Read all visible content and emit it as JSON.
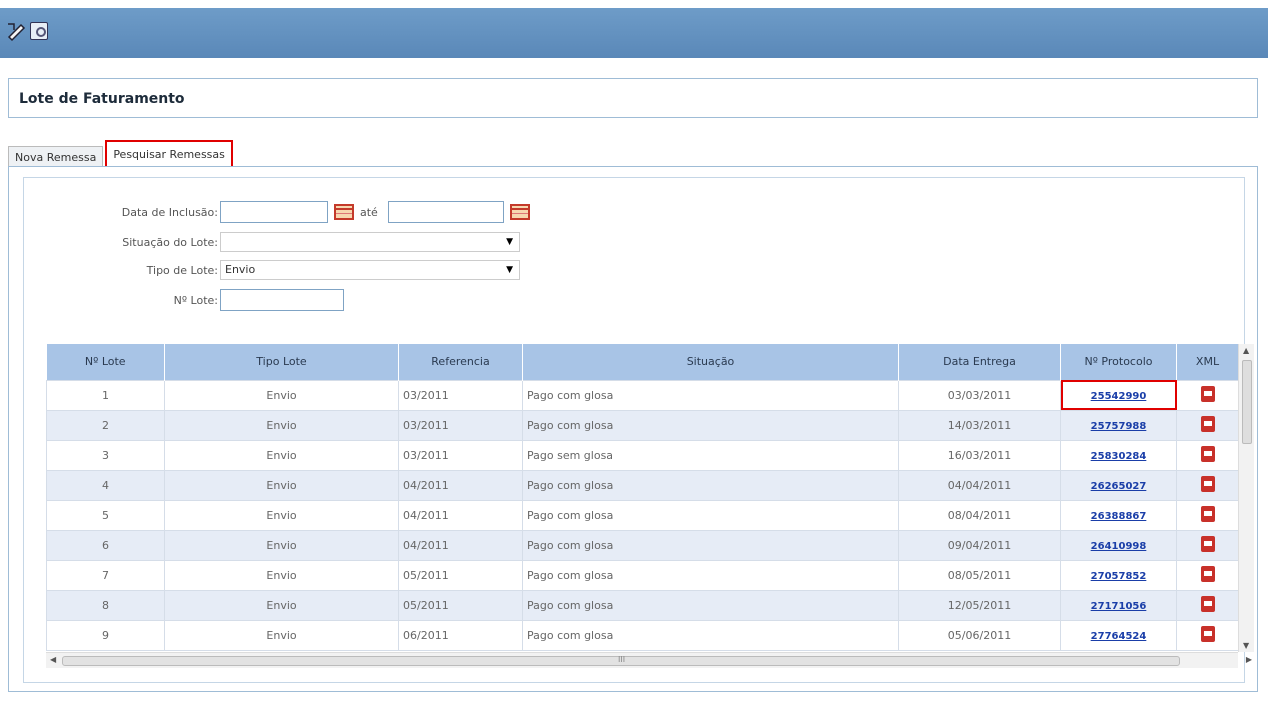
{
  "toolbar": {
    "icons": [
      "edit-pencil-icon",
      "download-icon"
    ]
  },
  "page_title": "Lote de Faturamento",
  "tabs": [
    {
      "label": "Nova Remessa",
      "active": false
    },
    {
      "label": "Pesquisar Remessas",
      "active": true
    }
  ],
  "form": {
    "data_inclusao_label": "Data de Inclusão:",
    "ate_label": "até",
    "data_inicio_value": "",
    "data_fim_value": "",
    "situacao_label": "Situação do Lote:",
    "situacao_value": "",
    "tipo_label": "Tipo de Lote:",
    "tipo_value": "Envio",
    "numero_label": "Nº Lote:",
    "numero_value": ""
  },
  "grid": {
    "headers": [
      "Nº Lote",
      "Tipo Lote",
      "Referencia",
      "Situação",
      "Data Entrega",
      "Nº Protocolo",
      "XML"
    ],
    "rows": [
      {
        "lote": "1",
        "tipo": "Envio",
        "ref": "03/2011",
        "situacao": "Pago com glosa",
        "data": "03/03/2011",
        "protocolo": "25542990"
      },
      {
        "lote": "2",
        "tipo": "Envio",
        "ref": "03/2011",
        "situacao": "Pago com glosa",
        "data": "14/03/2011",
        "protocolo": "25757988"
      },
      {
        "lote": "3",
        "tipo": "Envio",
        "ref": "03/2011",
        "situacao": "Pago sem glosa",
        "data": "16/03/2011",
        "protocolo": "25830284"
      },
      {
        "lote": "4",
        "tipo": "Envio",
        "ref": "04/2011",
        "situacao": "Pago com glosa",
        "data": "04/04/2011",
        "protocolo": "26265027"
      },
      {
        "lote": "5",
        "tipo": "Envio",
        "ref": "04/2011",
        "situacao": "Pago com glosa",
        "data": "08/04/2011",
        "protocolo": "26388867"
      },
      {
        "lote": "6",
        "tipo": "Envio",
        "ref": "04/2011",
        "situacao": "Pago com glosa",
        "data": "09/04/2011",
        "protocolo": "26410998"
      },
      {
        "lote": "7",
        "tipo": "Envio",
        "ref": "05/2011",
        "situacao": "Pago com glosa",
        "data": "08/05/2011",
        "protocolo": "27057852"
      },
      {
        "lote": "8",
        "tipo": "Envio",
        "ref": "05/2011",
        "situacao": "Pago com glosa",
        "data": "12/05/2011",
        "protocolo": "27171056"
      },
      {
        "lote": "9",
        "tipo": "Envio",
        "ref": "06/2011",
        "situacao": "Pago com glosa",
        "data": "05/06/2011",
        "protocolo": "27764524"
      }
    ]
  },
  "scrollbar": {
    "middle_glyph": "III"
  },
  "colors": {
    "header_bar": "#6e9cc8",
    "grid_header": "#a8c4e6",
    "alt_row": "#e6ecf6",
    "highlight": "#e00000",
    "link": "#1a3ea8"
  }
}
